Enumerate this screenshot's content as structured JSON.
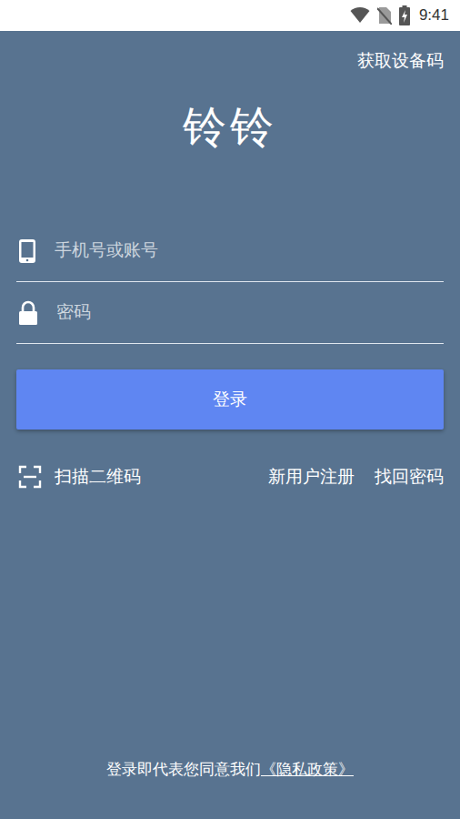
{
  "status_bar": {
    "time": "9:41"
  },
  "header": {
    "device_code_link": "获取设备码"
  },
  "logo": "铃铃",
  "fields": [
    {
      "placeholder": "手机号或账号",
      "kind": "account"
    },
    {
      "placeholder": "密码",
      "kind": "password"
    }
  ],
  "login_button": "登录",
  "links": {
    "scan": "扫描二维码",
    "register": "新用户注册",
    "forgot": "找回密码"
  },
  "footer": {
    "text": "登录即代表您同意我们",
    "policy_link": "《隐私政策》"
  }
}
